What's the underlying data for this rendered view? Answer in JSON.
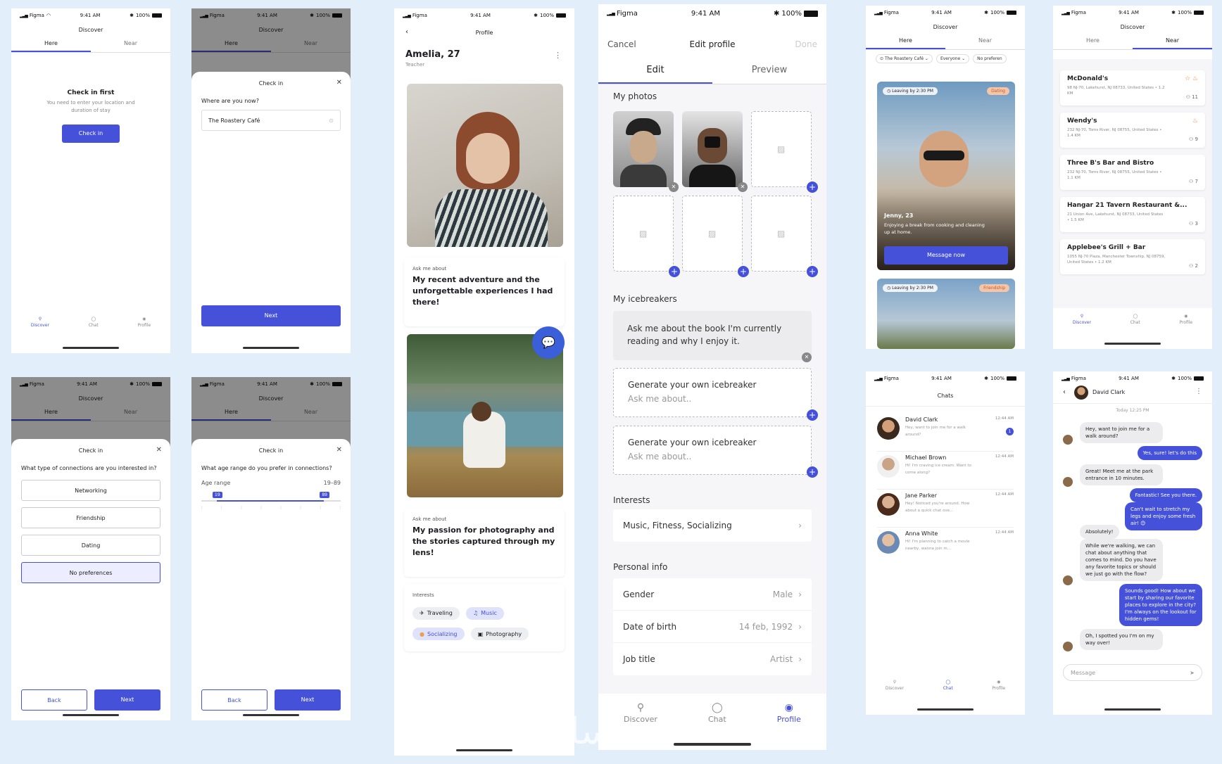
{
  "status": {
    "carrier": "Figma",
    "time": "9:41 AM",
    "battery": "100%"
  },
  "screen1": {
    "title": "Discover",
    "tab_here": "Here",
    "tab_near": "Near",
    "heading": "Check in first",
    "body": "You need to enter your location and duration of stay",
    "button": "Check in",
    "nav": [
      "Discover",
      "Chat",
      "Profile"
    ]
  },
  "screen2": {
    "title": "Discover",
    "tab_here": "Here",
    "tab_near": "Near",
    "sheet_title": "Check in",
    "question": "Where are you now?",
    "input_value": "The Roastery Café",
    "button": "Next"
  },
  "screen3": {
    "title": "Discover",
    "tab_here": "Here",
    "tab_near": "Near",
    "sheet_title": "Check in",
    "question": "What type of connections are you interested in?",
    "options": [
      "Networking",
      "Friendship",
      "Dating",
      "No preferences"
    ],
    "back": "Back",
    "next": "Next"
  },
  "screen4": {
    "title": "Discover",
    "tab_here": "Here",
    "tab_near": "Near",
    "sheet_title": "Check in",
    "question": "What age range do you prefer in connections?",
    "range_label": "Age range",
    "range_value": "19–89",
    "min": "19",
    "max": "89",
    "back": "Back",
    "next": "Next"
  },
  "profile": {
    "header": "Profile",
    "name": "Amelia, 27",
    "job": "Teacher",
    "ask_label_1": "Ask me about",
    "ask_text_1": "My recent adventure and the unforgettable experiences I had there!",
    "ask_label_2": "Ask me about",
    "ask_text_2": "My passion for photography and the stories captured through my lens!",
    "interests_label": "Interests",
    "interests": [
      {
        "icon": "plane-icon",
        "glyph": "✈",
        "label": "Traveling",
        "color": "#e6e8ee"
      },
      {
        "icon": "music-icon",
        "glyph": "♫",
        "label": "Music",
        "color": "#dfe2fb"
      },
      {
        "icon": "socializing-icon",
        "glyph": "●",
        "label": "Socializing",
        "color": "#dfe2fb"
      },
      {
        "icon": "camera-icon",
        "glyph": "▣",
        "label": "Photography",
        "color": "#eceef1"
      }
    ]
  },
  "edit": {
    "cancel": "Cancel",
    "title": "Edit profile",
    "done": "Done",
    "tab_edit": "Edit",
    "tab_preview": "Preview",
    "photos_label": "My photos",
    "icebreakers_label": "My icebreakers",
    "icebreaker_1": "Ask me about the book I'm currently reading and why I enjoy it.",
    "gen_title": "Generate your own icebreaker",
    "gen_placeholder": "Ask me about..",
    "interests_label": "Interests",
    "interests_value": "Music, Fitness, Socializing",
    "personal_label": "Personal info",
    "fields": [
      {
        "label": "Gender",
        "value": "Male"
      },
      {
        "label": "Date of birth",
        "value": "14 feb, 1992"
      },
      {
        "label": "Job title",
        "value": "Artist"
      }
    ],
    "nav": [
      "Discover",
      "Chat",
      "Profile"
    ]
  },
  "discover_here": {
    "title": "Discover",
    "tab_here": "Here",
    "tab_near": "Near",
    "filter_place": "The Roastery Café",
    "filter_who": "Everyone",
    "filter_pref": "No preferen",
    "card1_time": "Leaving by 2:30 PM",
    "card1_tag": "Dating",
    "card1_name": "Jenny, 23",
    "card1_text": "Enjoying a break from cooking and cleaning up at home.",
    "card1_button": "Message now",
    "card2_time": "Leaving by 2:30 PM",
    "card2_tag": "Friendship"
  },
  "near": {
    "title": "Discover",
    "tab_here": "Here",
    "tab_near": "Near",
    "places": [
      {
        "name": "McDonald's",
        "address": "98 NJ-70, Lakehurst, NJ 08733, United States • 1.2 KM",
        "count": "11"
      },
      {
        "name": "Wendy's",
        "address": "232 NJ-70, Toms River, NJ 08755, United States • 1.4 KM",
        "count": "9"
      },
      {
        "name": "Three B's Bar and Bistro",
        "address": "232 NJ-70, Toms River, NJ 08755, United States • 1.1 KM",
        "count": "7"
      },
      {
        "name": "Hangar 21 Tavern Restaurant &...",
        "address": "21 Union Ave, Lakehurst, NJ 08733, United States • 1.5 KM",
        "count": "3"
      },
      {
        "name": "Applebee's Grill + Bar",
        "address": "1055 NJ-70 Plaza, Manchester Township, NJ 08759, United States • 1.2 KM",
        "count": "2"
      }
    ],
    "nav": [
      "Discover",
      "Chat",
      "Profile"
    ]
  },
  "chats": {
    "title": "Chats",
    "items": [
      {
        "name": "David Clark",
        "msg": "Hey, want to join me for a walk around?",
        "time": "12:44 AM",
        "unread": "1"
      },
      {
        "name": "Michael Brown",
        "msg": "Hi! I'm craving ice cream. Want to come along?",
        "time": "12:44 AM"
      },
      {
        "name": "Jane Parker",
        "msg": "Hey! Noticed you're around. How about a quick chat ove...",
        "time": "12:44 AM"
      },
      {
        "name": "Anna White",
        "msg": "Hi! I'm planning to catch a movie nearby, wanna join m...",
        "time": "12:44 AM"
      }
    ],
    "nav": [
      "Discover",
      "Chat",
      "Profile"
    ]
  },
  "conversation": {
    "name": "David Clark",
    "date": "Today 12:25 PM",
    "messages": [
      "Hey, want to join me for a walk around?",
      "Yes, sure! let's do this",
      "Great! Meet me at the park entrance in 10 minutes.",
      "Fantastic! See you there.",
      "Can't wait to stretch my legs and enjoy some fresh air! 😊",
      "Absolutely!",
      "While we're walking, we can chat about anything that comes to mind. Do you have any favorite topics or should we just go with the flow?",
      "Sounds good! How about we start by sharing our favorite places to explore in the city? I'm always on the lookout for hidden gems!",
      "Oh, I spotted you I'm on my way over!"
    ],
    "input_placeholder": "Message"
  },
  "watermark": "خمسات",
  "colors": {
    "accent": "#4451d8",
    "background": "#e3eefb"
  }
}
